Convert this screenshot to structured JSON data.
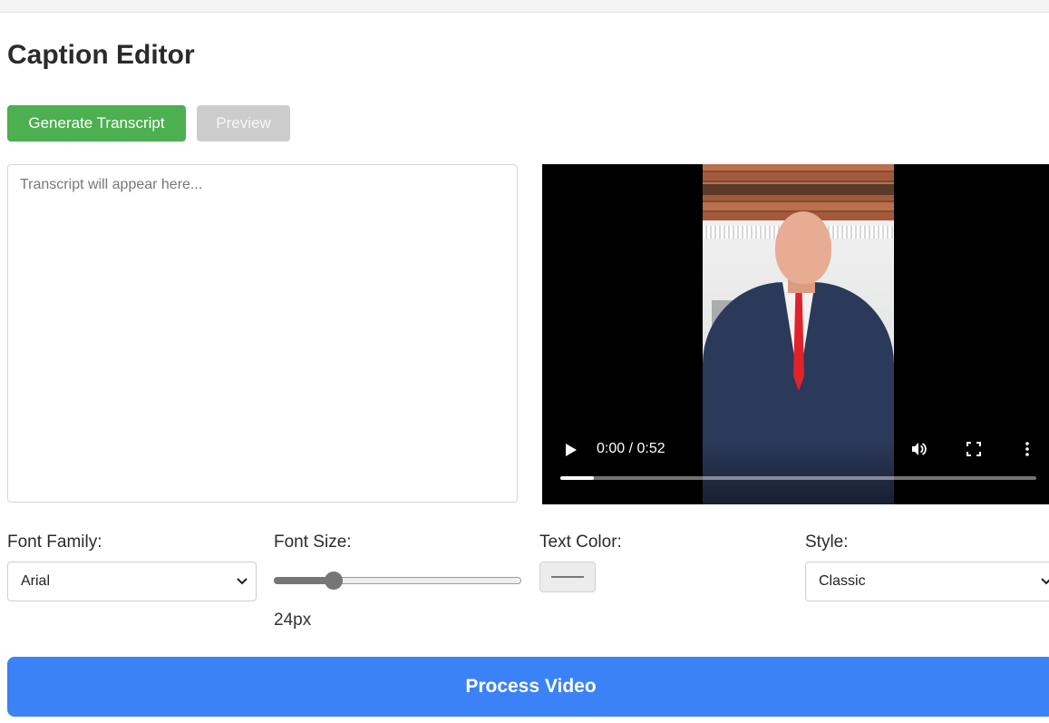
{
  "page": {
    "title": "Caption Editor"
  },
  "actions": {
    "generate_label": "Generate Transcript",
    "preview_label": "Preview"
  },
  "transcript": {
    "placeholder": "Transcript will appear here..."
  },
  "video": {
    "time": "0:00 / 0:52",
    "progress_fraction": 0.07
  },
  "controls": {
    "font_family": {
      "label": "Font Family:",
      "value": "Arial"
    },
    "font_size": {
      "label": "Font Size:",
      "value_text": "24px",
      "fraction": 0.24
    },
    "text_color": {
      "label": "Text Color:",
      "value": "#777777"
    },
    "style": {
      "label": "Style:",
      "value": "Classic"
    }
  },
  "process": {
    "label": "Process Video"
  },
  "colors": {
    "green": "#4caf50",
    "grey": "#cccccc",
    "blue": "#3b82f6",
    "video_bg": "#000000"
  }
}
